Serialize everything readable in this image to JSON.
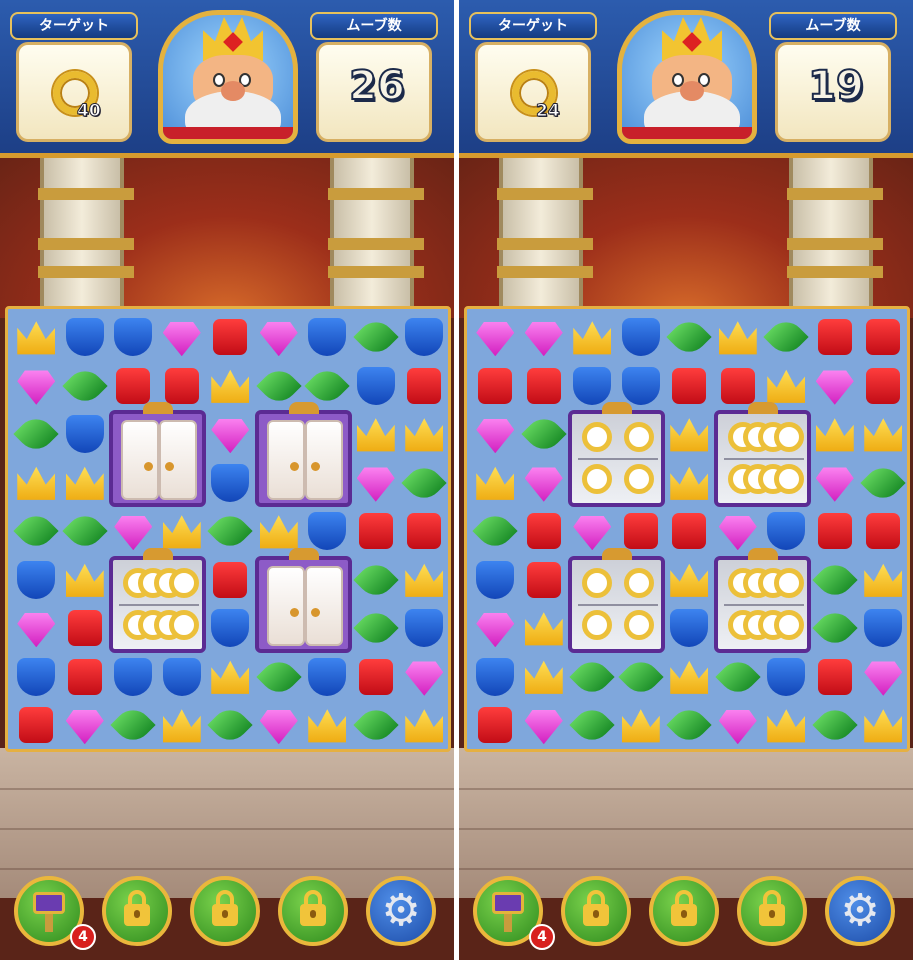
{
  "screens": [
    {
      "id": "left",
      "target_label": "ターゲット",
      "target_remaining": "40",
      "moves_label": "ムーブ数",
      "moves_remaining": "26",
      "booster_count": "4",
      "grid": [
        [
          "crown",
          "shield",
          "shield",
          "gem",
          "box",
          "gem",
          "shield",
          "leaf",
          "shield"
        ],
        [
          "gem",
          "leaf",
          "box",
          "box",
          "crown",
          "leaf",
          "leaf",
          "shield",
          "box"
        ],
        [
          "leaf",
          "shield",
          "",
          "",
          "gem",
          "",
          "",
          "crown",
          "crown"
        ],
        [
          "crown",
          "crown",
          "",
          "",
          "shield",
          "",
          "",
          "gem",
          "leaf"
        ],
        [
          "leaf",
          "leaf",
          "gem",
          "crown",
          "leaf",
          "crown",
          "shield",
          "box",
          "box"
        ],
        [
          "shield",
          "crown",
          "",
          "",
          "box",
          "",
          "",
          "leaf",
          "crown"
        ],
        [
          "gem",
          "box",
          "",
          "",
          "shield",
          "",
          "",
          "leaf",
          "shield"
        ],
        [
          "shield",
          "box",
          "shield",
          "shield",
          "crown",
          "leaf",
          "shield",
          "box",
          "gem"
        ],
        [
          "box",
          "gem",
          "leaf",
          "crown",
          "leaf",
          "gem",
          "crown",
          "leaf",
          "crown"
        ]
      ],
      "cabinets": [
        {
          "state": "closed",
          "plates_filled": 0
        },
        {
          "state": "closed",
          "plates_filled": 0
        },
        {
          "state": "open",
          "plates_filled": 8
        },
        {
          "state": "closed",
          "plates_filled": 0
        }
      ]
    },
    {
      "id": "right",
      "target_label": "ターゲット",
      "target_remaining": "24",
      "moves_label": "ムーブ数",
      "moves_remaining": "19",
      "booster_count": "4",
      "grid": [
        [
          "gem",
          "gem",
          "crown",
          "shield",
          "leaf",
          "crown",
          "leaf",
          "box",
          "box"
        ],
        [
          "box",
          "box",
          "shield",
          "shield",
          "box",
          "box",
          "crown",
          "gem",
          "box"
        ],
        [
          "gem",
          "leaf",
          "",
          "",
          "crown",
          "",
          "",
          "crown",
          "crown"
        ],
        [
          "crown",
          "gem",
          "",
          "",
          "crown",
          "",
          "",
          "gem",
          "leaf"
        ],
        [
          "leaf",
          "box",
          "gem",
          "box",
          "box",
          "gem",
          "shield",
          "box",
          "box"
        ],
        [
          "shield",
          "box",
          "",
          "",
          "crown",
          "",
          "",
          "leaf",
          "crown"
        ],
        [
          "gem",
          "crown",
          "",
          "",
          "shield",
          "",
          "",
          "leaf",
          "shield"
        ],
        [
          "shield",
          "crown",
          "leaf",
          "leaf",
          "crown",
          "leaf",
          "shield",
          "box",
          "gem"
        ],
        [
          "box",
          "gem",
          "leaf",
          "crown",
          "leaf",
          "gem",
          "crown",
          "leaf",
          "crown"
        ]
      ],
      "cabinets": [
        {
          "state": "open",
          "plates_filled": 4
        },
        {
          "state": "open",
          "plates_filled": 8
        },
        {
          "state": "open",
          "plates_filled": 4
        },
        {
          "state": "open",
          "plates_filled": 8
        }
      ]
    }
  ],
  "bottom_buttons": [
    {
      "icon": "hammer-icon",
      "locked": false
    },
    {
      "icon": "lock-icon",
      "locked": true
    },
    {
      "icon": "lock-icon",
      "locked": true
    },
    {
      "icon": "lock-icon",
      "locked": true
    },
    {
      "icon": "gear-icon",
      "locked": false
    }
  ],
  "colors": {
    "board": "#7fa7dc",
    "frame": "#e5b042",
    "topbar": "#1d3f86"
  }
}
